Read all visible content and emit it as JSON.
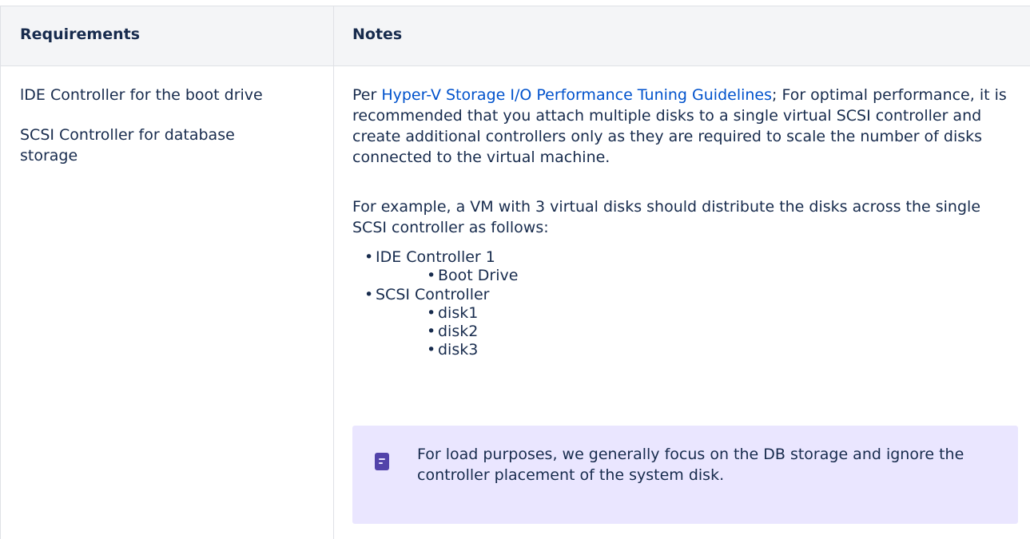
{
  "table": {
    "headers": {
      "requirements": "Requirements",
      "notes": "Notes"
    },
    "requirements": {
      "line1": "lDE Controller for the boot drive",
      "line2": "SCSI Controller for database storage"
    },
    "notes": {
      "para1_prefix": "Per ",
      "para1_link": "Hyper-V Storage I/O Performance Tuning Guidelines",
      "para1_rest": "; For optimal performance, it is recommended that you attach multiple disks to a single virtual SCSI controller and create additional controllers only as they are required to scale the number of disks connected to the virtual machine.",
      "para2": "For example, a VM with 3 virtual disks should distribute the disks across the single SCSI controller as follows:",
      "list": [
        {
          "label": "IDE Controller 1",
          "children": [
            "Boot Drive"
          ]
        },
        {
          "label": "SCSI Controller",
          "children": [
            "disk1",
            "disk2",
            "disk3"
          ]
        }
      ],
      "note_panel": {
        "icon": "note-icon",
        "text": "For load purposes, we generally focus on the DB storage and ignore the controller placement of the system disk."
      }
    }
  },
  "colors": {
    "link": "#0052cc",
    "header_bg": "#f4f5f7",
    "border": "#dfe1e6",
    "note_bg": "#eae6ff",
    "note_icon": "#5243aa",
    "text": "#172b4d"
  }
}
